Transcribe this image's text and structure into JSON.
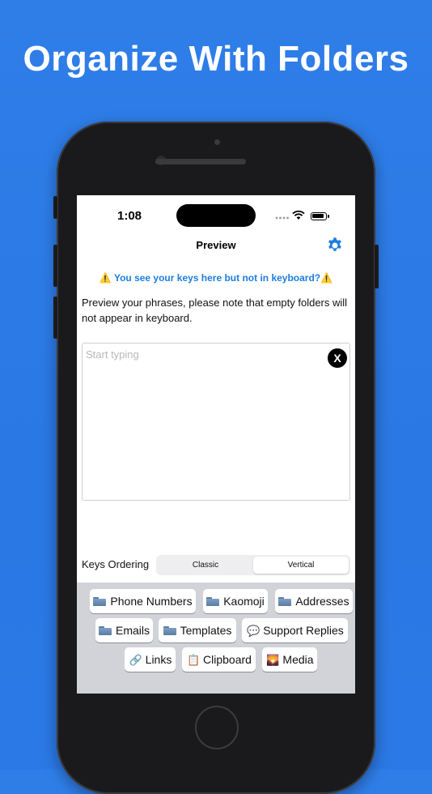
{
  "headline": "Organize With Folders",
  "status_bar": {
    "time": "1:08"
  },
  "nav": {
    "title": "Preview",
    "settings_icon": "gear-icon"
  },
  "warning": {
    "text": "⚠️ You see your keys here but not in keyboard?⚠️"
  },
  "description": "Preview your phrases, please note that empty folders will not appear in keyboard.",
  "editor": {
    "placeholder": "Start typing",
    "clear_label": "X"
  },
  "ordering": {
    "label": "Keys Ordering",
    "options": [
      "Classic",
      "Vertical"
    ],
    "selected": "Vertical"
  },
  "keyboard": {
    "keys": [
      {
        "label": "Phone Numbers",
        "icon": "folder-icon"
      },
      {
        "label": "Kaomoji",
        "icon": "folder-icon"
      },
      {
        "label": "Addresses",
        "icon": "folder-icon"
      },
      {
        "label": "Emails",
        "icon": "folder-icon"
      },
      {
        "label": "Templates",
        "icon": "folder-icon"
      },
      {
        "label": "Support Replies",
        "icon": "speech-bubble-icon",
        "glyph": "💬"
      },
      {
        "label": "Links",
        "icon": "link-icon",
        "glyph": "🔗"
      },
      {
        "label": "Clipboard",
        "icon": "clipboard-icon",
        "glyph": "📋"
      },
      {
        "label": "Media",
        "icon": "media-icon",
        "glyph": "🌄"
      }
    ]
  },
  "colors": {
    "background": "#2f7ee8",
    "accent": "#1d7de0",
    "keyboard_bg": "#d1d3d9"
  }
}
